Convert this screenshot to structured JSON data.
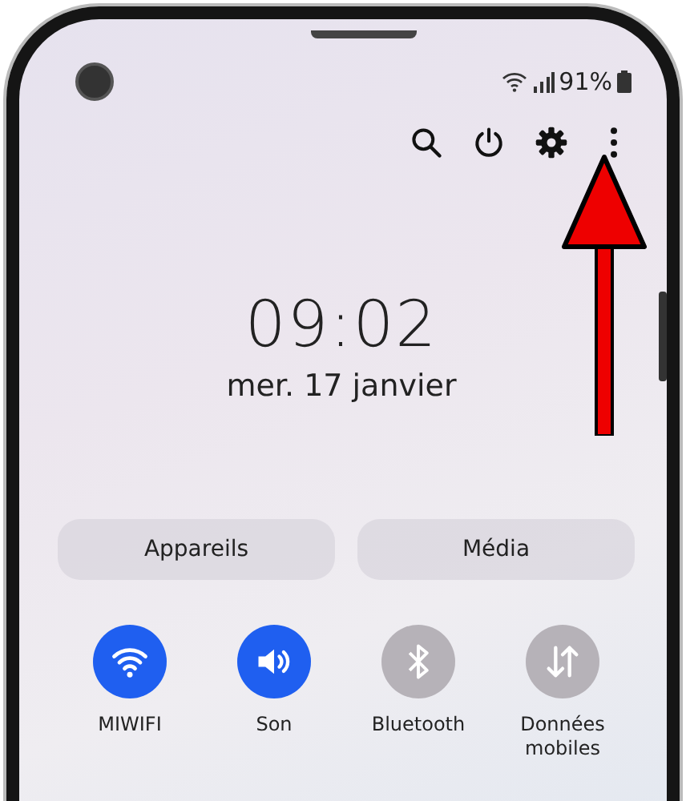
{
  "status_bar": {
    "battery": "91%"
  },
  "clock": {
    "time": "09:02",
    "date": "mer. 17 janvier"
  },
  "panel_buttons": [
    {
      "label": "Appareils"
    },
    {
      "label": "Média"
    }
  ],
  "tiles": [
    {
      "label": "MIWIFI",
      "on": true
    },
    {
      "label": "Son",
      "on": true
    },
    {
      "label": "Bluetooth",
      "on": false
    },
    {
      "label": "Données mobiles",
      "on": false
    }
  ]
}
